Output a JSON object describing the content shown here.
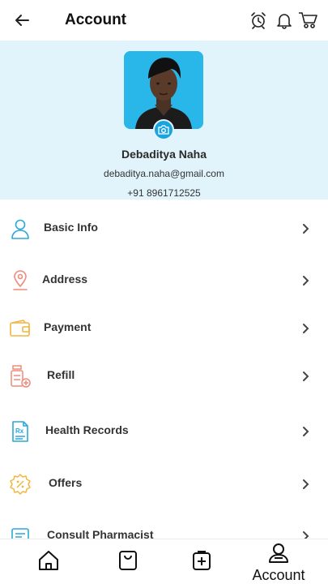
{
  "header": {
    "title": "Account",
    "icons": [
      "back-arrow-icon",
      "alarm-clock-icon",
      "bell-icon",
      "cart-icon"
    ]
  },
  "profile": {
    "name": "Debaditya Naha",
    "email": "debaditya.naha@gmail.com",
    "phone": "+91 8961712525",
    "avatar_bg": "#29b6e8",
    "panel_bg": "#e1f3fb"
  },
  "menu": {
    "items": [
      {
        "label": "Basic Info",
        "icon": "user-icon",
        "color": "#2aa9d8"
      },
      {
        "label": "Address",
        "icon": "location-pin-icon",
        "color": "#f08a7a"
      },
      {
        "label": "Payment",
        "icon": "wallet-icon",
        "color": "#f2b63d"
      },
      {
        "label": "Refill",
        "icon": "medicine-bottle-icon",
        "color": "#f08a7a"
      },
      {
        "label": "Health Records",
        "icon": "prescription-document-icon",
        "color": "#2aa9d8"
      },
      {
        "label": "Offers",
        "icon": "discount-badge-icon",
        "color": "#f2b63d"
      },
      {
        "label": "Consult Pharmacist",
        "icon": "chat-icon",
        "color": "#2aa9d8"
      }
    ]
  },
  "bottom_nav": {
    "items": [
      {
        "icon": "home-icon",
        "label": ""
      },
      {
        "icon": "shopping-bag-icon",
        "label": ""
      },
      {
        "icon": "prescription-plus-icon",
        "label": ""
      },
      {
        "icon": "account-icon",
        "label": "Account"
      }
    ]
  }
}
